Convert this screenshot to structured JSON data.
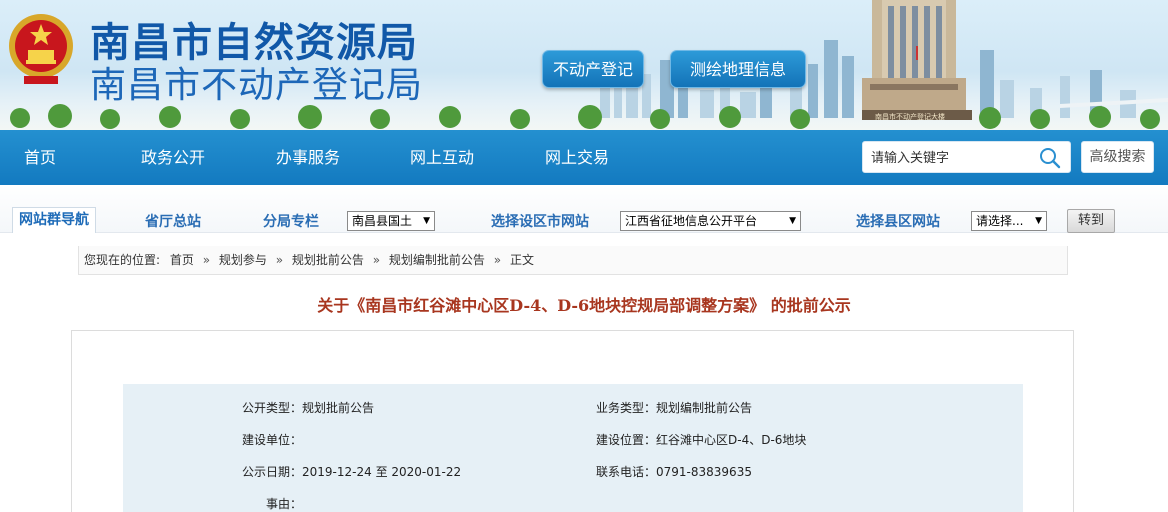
{
  "header": {
    "title_line1": "南昌市自然资源局",
    "title_line2": "南昌市不动产登记局",
    "btn_register": "不动产登记",
    "btn_survey": "测绘地理信息",
    "building_sign": "南昌市不动产登记大楼"
  },
  "nav": {
    "items": [
      "首页",
      "政务公开",
      "办事服务",
      "网上互动",
      "网上交易"
    ],
    "search_placeholder": "请输入关键字",
    "advanced_search": "高级搜索"
  },
  "subnav": {
    "active_tab": "网站群导航",
    "provincial": "省厅总站",
    "branch": "分局专栏",
    "branch_select": "南昌县国土",
    "district_label": "选择设区市网站",
    "district_select": "江西省征地信息公开平台",
    "county_label": "选择县区网站",
    "county_select": "请选择...",
    "go_button": "转到"
  },
  "breadcrumb": {
    "prefix": "您现在的位置:",
    "items": [
      "首页",
      "规划参与",
      "规划批前公告",
      "规划编制批前公告",
      "正文"
    ],
    "separator": "»"
  },
  "article": {
    "title": "关于《南昌市红谷滩中心区D-4、D-6地块控规局部调整方案》 的批前公示"
  },
  "info": {
    "public_type_label": "公开类型：",
    "public_type_value": "规划批前公告",
    "business_type_label": "业务类型：",
    "business_type_value": "规划编制批前公告",
    "unit_label": "建设单位：",
    "unit_value": "",
    "location_label": "建设位置：",
    "location_value": "红谷滩中心区D-4、D-6地块",
    "date_label": "公示日期：",
    "date_value": "2019-12-24 至 2020-01-22",
    "phone_label": "联系电话：",
    "phone_value": "0791-83839635",
    "reason_label": "事由："
  },
  "colors": {
    "title_blue": "#1158a8",
    "nav_blue": "#1a84c8",
    "article_title_red": "#a8361f",
    "info_panel_bg": "#e6f0f6"
  }
}
